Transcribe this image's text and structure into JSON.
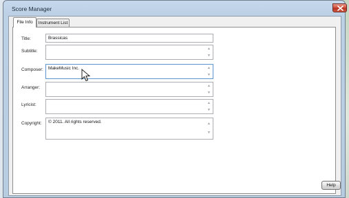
{
  "window": {
    "title": "Score Manager",
    "close_label": "x"
  },
  "tabs": [
    {
      "label": "File Info",
      "active": true
    },
    {
      "label": "Instrument List",
      "active": false
    }
  ],
  "fields": {
    "title": {
      "label": "Title:",
      "value": "Brassicas"
    },
    "subtitle": {
      "label": "Subtitle:",
      "value": ""
    },
    "composer": {
      "label": "Composer:",
      "value": "MakeMusic Inc."
    },
    "arranger": {
      "label": "Arranger:",
      "value": ""
    },
    "lyricist": {
      "label": "Lyricist:",
      "value": ""
    },
    "copyright": {
      "label": "Copyright:",
      "value": "© 2011. All rights reserved."
    }
  },
  "buttons": {
    "help": "Help"
  },
  "icons": {
    "close": "close-icon",
    "scroll_up": "chevron-up-icon",
    "scroll_down": "chevron-down-icon",
    "cursor": "mouse-pointer-icon"
  },
  "colors": {
    "close_button": "#c9412d",
    "focus_border": "#5b95cf"
  }
}
